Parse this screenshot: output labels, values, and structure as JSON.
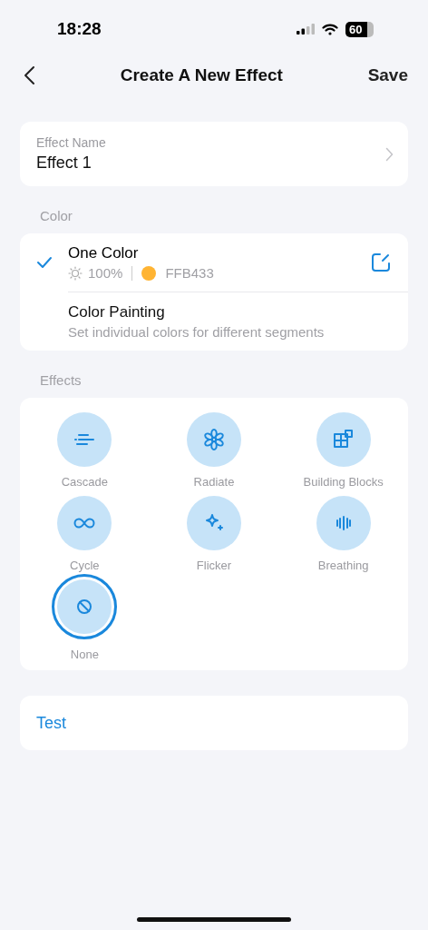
{
  "status_bar": {
    "time": "18:28",
    "battery": "60"
  },
  "nav": {
    "title": "Create A New Effect",
    "action": "Save"
  },
  "name_field": {
    "label": "Effect Name",
    "value": "Effect 1"
  },
  "color_section": {
    "heading": "Color",
    "options": [
      {
        "kind": "single",
        "title": "One Color",
        "selected": true,
        "brightness": "100%",
        "color": "#ffb433",
        "hex": "FFB433"
      },
      {
        "kind": "painting",
        "title": "Color Painting",
        "selected": false,
        "subtitle": "Set individual colors for different segments"
      }
    ]
  },
  "effects_section": {
    "heading": "Effects",
    "items": [
      {
        "kind": "cascade",
        "label": "Cascade",
        "selected": false
      },
      {
        "kind": "radiate",
        "label": "Radiate",
        "selected": false
      },
      {
        "kind": "blocks",
        "label": "Building Blocks",
        "selected": false
      },
      {
        "kind": "cycle",
        "label": "Cycle",
        "selected": false
      },
      {
        "kind": "flicker",
        "label": "Flicker",
        "selected": false
      },
      {
        "kind": "breathing",
        "label": "Breathing",
        "selected": false
      },
      {
        "kind": "none",
        "label": "None",
        "selected": true
      }
    ]
  },
  "test_button": {
    "label": "Test"
  }
}
